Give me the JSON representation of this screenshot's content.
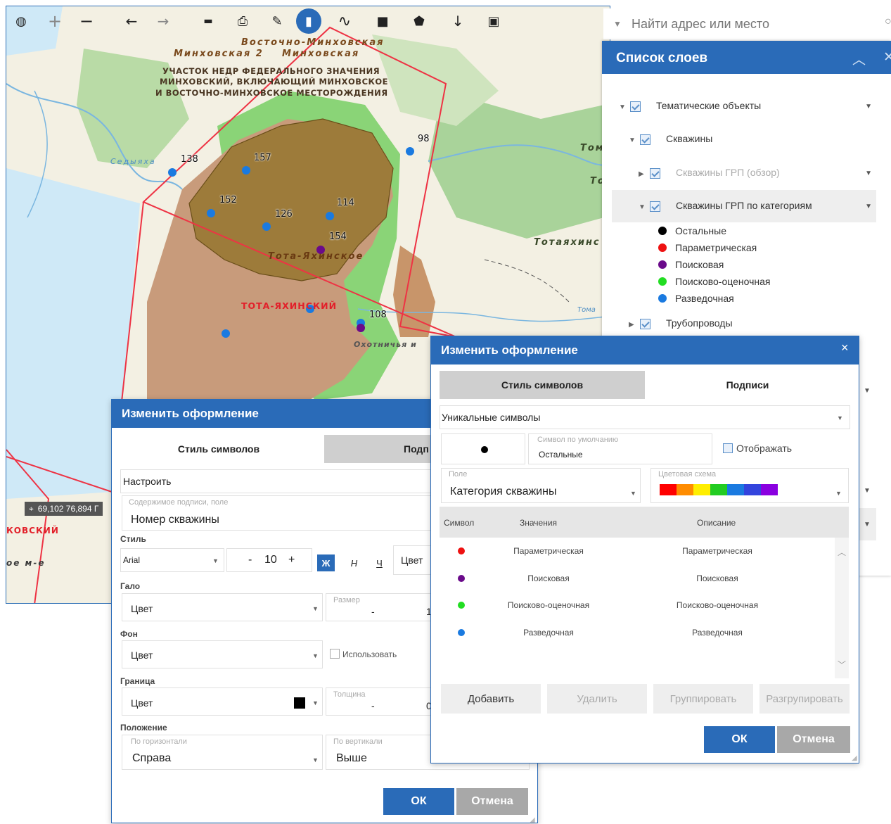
{
  "toolbar": {
    "buttons": [
      {
        "name": "globe-icon",
        "glyph": "◍"
      },
      {
        "name": "zoom-in-icon",
        "glyph": "+"
      },
      {
        "name": "zoom-out-icon",
        "glyph": "−"
      },
      {
        "name": "back-icon",
        "glyph": "←"
      },
      {
        "name": "forward-icon",
        "glyph": "→"
      },
      {
        "name": "ruler-icon",
        "glyph": "▬"
      },
      {
        "name": "print-icon",
        "glyph": "⎙"
      },
      {
        "name": "pen-icon",
        "glyph": "✎"
      },
      {
        "name": "marker-icon",
        "glyph": "▮"
      },
      {
        "name": "polyline-icon",
        "glyph": "∿"
      },
      {
        "name": "rectangle-icon",
        "glyph": "■"
      },
      {
        "name": "polygon-icon",
        "glyph": "⬟"
      },
      {
        "name": "download-icon",
        "glyph": "↓"
      },
      {
        "name": "save-icon",
        "glyph": "💾"
      }
    ]
  },
  "map": {
    "labels": {
      "vostochno": "Восточно-Минховская",
      "minkh2": "Минховская 2",
      "minkh": "Минховская",
      "area1": "УЧАСТОК НЕДР ФЕДЕРАЛЬНОГО ЗНАЧЕНИЯ",
      "area2": "МИНХОВСКИЙ, ВКЛЮЧАЮЩИЙ МИНХОВСКОЕ",
      "area3": "И ВОСТОЧНО-МИНХОВСКОЕ МЕСТОРОЖДЕНИЯ",
      "tota_field": "Тота-Яхинское",
      "tota_area": "ТОТА-ЯХИНСКИЙ",
      "sedyakha": "Седыяха",
      "tom": "Том",
      "to": "То",
      "totayakhin": "Тотаяхинс",
      "toma": "Тома",
      "okhotnich": "Охотничья и",
      "kovsky": "КОВСКИЙ",
      "oe_m_e": "ое м-е"
    },
    "wells": [
      "138",
      "157",
      "98",
      "152",
      "126",
      "114",
      "154",
      "108"
    ],
    "coords_readout": "69,102 76,894 Г"
  },
  "search": {
    "placeholder": "Найти адрес или место"
  },
  "layers": {
    "title": "Список слоев",
    "items": [
      {
        "label": "Тематические объекты"
      },
      {
        "label": "Скважины"
      },
      {
        "label": "Скважины ГРП (обзор)"
      },
      {
        "label": "Скважины ГРП по категориям"
      },
      {
        "label": "Трубопроводы"
      }
    ],
    "legend": [
      {
        "label": "Остальные",
        "color": "#000000"
      },
      {
        "label": "Параметрическая",
        "color": "#ee1111"
      },
      {
        "label": "Поисковая",
        "color": "#6a0a8a"
      },
      {
        "label": "Поисково-оценочная",
        "color": "#22dd22"
      },
      {
        "label": "Разведочная",
        "color": "#1a7ae0"
      }
    ]
  },
  "dialog_left": {
    "title": "Изменить оформление",
    "tab_style": "Стиль символов",
    "tab_labels": "Подп",
    "customize": "Настроить",
    "content_label": "Содержимое подписи, поле",
    "content_value": "Номер скважины",
    "style_section": "Стиль",
    "font": "Arial",
    "size_minus": "-",
    "size_value": "10",
    "size_plus": "+",
    "bold": "Ж",
    "italic": "Н",
    "underline": "Ч",
    "color_btn": "Цвет",
    "halo_section": "Гало",
    "halo_color": "Цвет",
    "halo_size_label": "Размер",
    "halo_size_minus": "-",
    "halo_size_value": "1",
    "bg_section": "Фон",
    "bg_color": "Цвет",
    "bg_use": "Использовать",
    "border_section": "Граница",
    "border_color": "Цвет",
    "thickness_label": "Толщина",
    "thickness_minus": "-",
    "thickness_value": "0",
    "position_section": "Положение",
    "horiz_label": "По горизонтали",
    "horiz_value": "Справа",
    "vert_label": "По вертикали",
    "vert_value": "Выше",
    "ok": "ОК",
    "cancel": "Отмена"
  },
  "dialog_right": {
    "title": "Изменить оформление",
    "close": "×",
    "tab_style": "Стиль символов",
    "tab_labels": "Подписи",
    "renderer": "Уникальные символы",
    "default_symbol_label": "Символ по умолчанию",
    "default_symbol_value": "Остальные",
    "display": "Отображать",
    "field_label": "Поле",
    "field_value": "Категория скважины",
    "scheme_label": "Цветовая схема",
    "scheme_colors": [
      "#ff0000",
      "#ff8c00",
      "#ffee00",
      "#22cc22",
      "#1a7ae0",
      "#3344dd",
      "#8a00e0"
    ],
    "col_symbol": "Символ",
    "col_values": "Значения",
    "col_description": "Описание",
    "rows": [
      {
        "value": "Параметрическая",
        "description": "Параметрическая",
        "color": "#ee1111"
      },
      {
        "value": "Поисковая",
        "description": "Поисковая",
        "color": "#6a0a8a"
      },
      {
        "value": "Поисково-оценочная",
        "description": "Поисково-оценочная",
        "color": "#22dd22"
      },
      {
        "value": "Разведочная",
        "description": "Разведочная",
        "color": "#1a7ae0"
      }
    ],
    "add": "Добавить",
    "delete": "Удалить",
    "group": "Группировать",
    "ungroup": "Разгрупировать",
    "ok": "ОК",
    "cancel": "Отмена"
  }
}
